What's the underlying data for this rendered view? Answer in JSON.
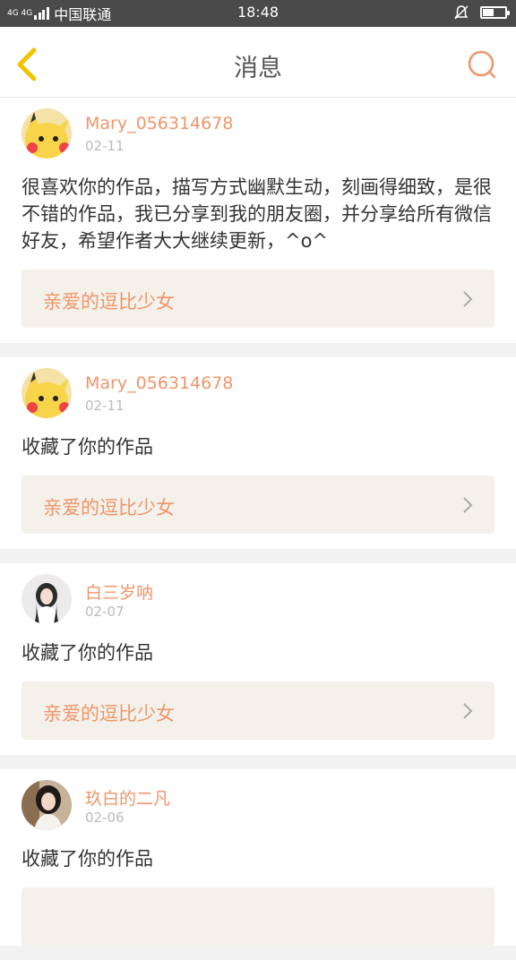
{
  "statusbar": {
    "network": "4G 4G",
    "carrier": "中国联通",
    "time": "18:48"
  },
  "nav": {
    "title": "消息",
    "back_icon": "chevron-left-icon",
    "search_icon": "search-icon"
  },
  "colors": {
    "accent": "#f0956a",
    "back": "#f3c300",
    "link_bg": "#f3f1ea"
  },
  "messages": [
    {
      "user": "Mary_056314678",
      "date": "02-11",
      "text": "很喜欢你的作品，描写方式幽默生动，刻画得细致，是很不错的作品，我已分享到我的朋友圈，并分享给所有微信好友，希望作者大大继续更新，^o^",
      "link": "亲爱的逗比少女"
    },
    {
      "user": "Mary_056314678",
      "date": "02-11",
      "text": "收藏了你的作品",
      "link": "亲爱的逗比少女"
    },
    {
      "user": "白三岁呐",
      "date": "02-07",
      "text": "收藏了你的作品",
      "link": "亲爱的逗比少女"
    },
    {
      "user": "玖白的二凡",
      "date": "02-06",
      "text": "收藏了你的作品",
      "link": ""
    }
  ]
}
